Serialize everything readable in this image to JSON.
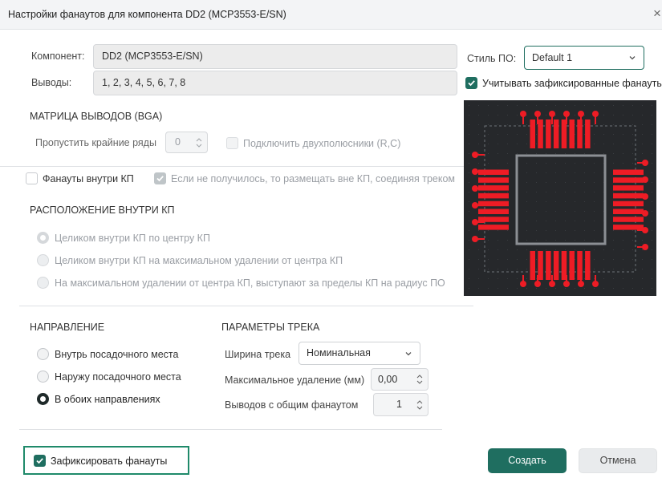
{
  "window": {
    "title": "Настройки фанаутов для компонента DD2 (MCP3553-E/SN)",
    "close_glyph": "×"
  },
  "component": {
    "label": "Компонент:",
    "value": "DD2 (MCP3553-E/SN)"
  },
  "pins": {
    "label": "Выводы:",
    "value": "1, 2, 3, 4, 5, 6, 7, 8"
  },
  "style": {
    "label": "Стиль ПО:",
    "selected": "Default 1"
  },
  "consider_fixed": {
    "label": "Учитывать зафиксированные фанауты",
    "checked": true
  },
  "bga": {
    "title": "МАТРИЦА ВЫВОДОВ (BGA)",
    "skip_rows_label": "Пропустить крайние ряды",
    "skip_rows_value": "0",
    "two_terminal_label": "Подключить двухполюсники (R,C)"
  },
  "inside": {
    "fanouts_label": "Фанауты внутри КП",
    "fallback_label": "Если не получилось, то размещать вне КП, соединяя треком"
  },
  "placement": {
    "title": "РАСПОЛОЖЕНИЕ ВНУТРИ КП",
    "options": [
      "Целиком внутри КП по центру КП",
      "Целиком внутри КП на максимальном удалении от центра КП",
      "На максимальном удалении от центра КП, выступают за пределы КП на радиус ПО"
    ]
  },
  "direction": {
    "title": "НАПРАВЛЕНИЕ",
    "options": [
      "Внутрь посадочного места",
      "Наружу посадочного места",
      "В обоих направлениях"
    ],
    "selected_index": 2
  },
  "track": {
    "title": "ПАРАМЕТРЫ ТРЕКА",
    "width_label": "Ширина трека",
    "width_value": "Номинальная",
    "max_offset_label": "Максимальное удаление (мм)",
    "max_offset_value": "0,00",
    "shared_label": "Выводов с общим фанаутом",
    "shared_value": "1"
  },
  "fix": {
    "label": "Зафиксировать фанауты",
    "checked": true
  },
  "buttons": {
    "create": "Создать",
    "cancel": "Отмена"
  },
  "preview": {
    "background": "#26282b",
    "pad_color": "#ee1c25",
    "outline_color": "#8c8f94",
    "pins_per_side": 8
  },
  "colors": {
    "accent": "#1f6e60"
  }
}
